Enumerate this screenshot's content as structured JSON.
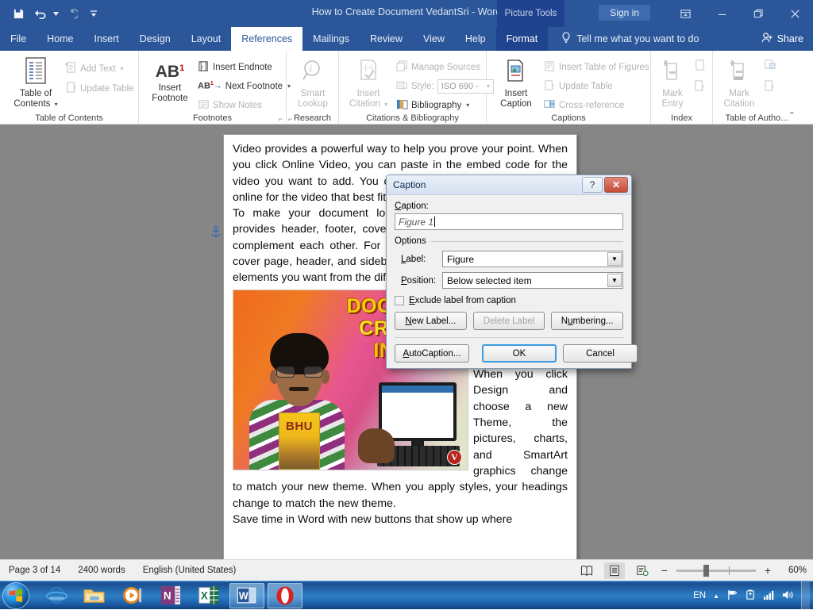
{
  "titlebar": {
    "document_title": "How to Create Document VedantSri  -  Word",
    "quick_access": [
      {
        "name": "save",
        "icon": "save-icon"
      },
      {
        "name": "undo",
        "icon": "undo-icon"
      },
      {
        "name": "redo",
        "icon": "redo-icon"
      },
      {
        "name": "customize",
        "icon": "customize-qat-icon"
      }
    ],
    "context_tools_label": "Picture Tools",
    "signin_label": "Sign in",
    "window_buttons": [
      {
        "name": "ribbon-display-options",
        "glyph": "⬒"
      },
      {
        "name": "minimize",
        "glyph": "—"
      },
      {
        "name": "restore",
        "glyph": "❐"
      },
      {
        "name": "close",
        "glyph": "✕"
      }
    ]
  },
  "tabs": [
    {
      "label": "File",
      "active": false
    },
    {
      "label": "Home",
      "active": false
    },
    {
      "label": "Insert",
      "active": false
    },
    {
      "label": "Design",
      "active": false
    },
    {
      "label": "Layout",
      "active": false
    },
    {
      "label": "References",
      "active": true
    },
    {
      "label": "Mailings",
      "active": false
    },
    {
      "label": "Review",
      "active": false
    },
    {
      "label": "View",
      "active": false
    },
    {
      "label": "Help",
      "active": false
    }
  ],
  "context_tab": {
    "label": "Format"
  },
  "tellme": {
    "placeholder": "Tell me what you want to do"
  },
  "share": {
    "label": "Share"
  },
  "ribbon": {
    "groups": [
      {
        "title": "Table of Contents",
        "big": {
          "label1": "Table of",
          "label2": "Contents",
          "dim": false
        },
        "items": [
          {
            "label": "Add Text",
            "dim": true,
            "has_caret": true
          },
          {
            "label": "Update Table",
            "dim": true,
            "has_caret": false
          }
        ]
      },
      {
        "title": "Footnotes",
        "big": {
          "label1": "Insert",
          "label2": "Footnote",
          "glyph": "AB",
          "sup": "1",
          "dim": false
        },
        "items": [
          {
            "label": "Insert Endnote",
            "dim": false,
            "has_caret": false
          },
          {
            "label": "Next Footnote",
            "dim": false,
            "has_caret": true
          },
          {
            "label": "Show Notes",
            "dim": true,
            "has_caret": false
          }
        ]
      },
      {
        "title": "Research",
        "big": {
          "label1": "Smart",
          "label2": "Lookup",
          "dim": true
        }
      },
      {
        "title": "Citations & Bibliography",
        "big": {
          "label1": "Insert",
          "label2": "Citation",
          "dim": true
        },
        "items": [
          {
            "label": "Manage Sources",
            "dim": true,
            "has_caret": false
          },
          {
            "label": "Style:",
            "dim": true,
            "has_caret": false
          },
          {
            "label": "Bibliography",
            "dim": false,
            "has_caret": true
          }
        ],
        "style_value": "ISO 690 -"
      },
      {
        "title": "Captions",
        "big": {
          "label1": "Insert",
          "label2": "Caption",
          "dim": false
        },
        "items": [
          {
            "label": "Insert Table of Figures",
            "dim": true,
            "has_caret": false
          },
          {
            "label": "Update Table",
            "dim": true,
            "has_caret": false
          },
          {
            "label": "Cross-reference",
            "dim": true,
            "has_caret": false
          }
        ]
      },
      {
        "title": "Index",
        "big": {
          "label1": "Mark",
          "label2": "Entry",
          "dim": true
        }
      },
      {
        "title": "Table of Autho...",
        "big": {
          "label1": "Mark",
          "label2": "Citation",
          "dim": true
        }
      }
    ],
    "collapse_label": "⌃"
  },
  "document": {
    "paragraph1": "Video provides a powerful way to help you prove your point. When you click Online Video, you can paste in the embed code for the video you want to add. You can also type a keyword to search online for the video that best fits your document.",
    "paragraph2": "To make your document look professionally produced, Word provides header, footer, cover page, and text box designs that complement each other. For example, you can add a matching cover page, header, and sidebar. Click Insert and then choose the elements you want from the different galleries.",
    "paragraph3": "Themes and styles also help keep your document coordinated. When you click Design and choose a new Theme, the pictures, charts, and SmartArt graphics change to match your new theme. When you apply styles, your headings change to match the new theme.",
    "paragraph4": "Save time in Word with new buttons that show up where",
    "image": {
      "title_line1": "DOCUMENT",
      "title_line2": "CREATION",
      "title_line3": "IN WORD",
      "book_label": "BHU",
      "logo_label": "V"
    }
  },
  "dialog": {
    "title": "Caption",
    "help_glyph": "?",
    "close_glyph": "✕",
    "caption_label": "Caption:",
    "caption_value": "Figure 1",
    "options_label": "Options",
    "label_field_label": "Label:",
    "label_value": "Figure",
    "position_field_label": "Position:",
    "position_value": "Below selected item",
    "exclude_label": "Exclude label from caption",
    "exclude_checked": false,
    "buttons": [
      {
        "label": "New Label...",
        "dim": false,
        "default": false
      },
      {
        "label": "Delete Label",
        "dim": true,
        "default": false
      },
      {
        "label": "Numbering...",
        "dim": false,
        "default": false
      }
    ],
    "buttons2": [
      {
        "label": "AutoCaption...",
        "dim": false,
        "default": false
      },
      {
        "label": "OK",
        "dim": false,
        "default": true
      },
      {
        "label": "Cancel",
        "dim": false,
        "default": false
      }
    ]
  },
  "statusbar": {
    "page": "Page 3 of 14",
    "words": "2400 words",
    "language": "English (United States)",
    "views": [
      {
        "name": "read-mode",
        "active": false
      },
      {
        "name": "print-layout",
        "active": true
      },
      {
        "name": "web-layout",
        "active": false
      }
    ],
    "zoom_out": "−",
    "zoom_in": "+",
    "zoom_level": "60%"
  },
  "taskbar": {
    "start_label": "Start",
    "items": [
      {
        "name": "internet-explorer",
        "label": "Internet Explorer",
        "running": false
      },
      {
        "name": "file-explorer",
        "label": "File Explorer",
        "running": false
      },
      {
        "name": "media-player",
        "label": "Windows Media Player",
        "running": false
      },
      {
        "name": "onenote",
        "label": "OneNote",
        "running": false
      },
      {
        "name": "excel",
        "label": "Excel",
        "running": false
      },
      {
        "name": "word",
        "label": "Word",
        "running": true
      },
      {
        "name": "opera",
        "label": "Opera",
        "running": true
      }
    ],
    "tray": {
      "language": "EN",
      "icons": [
        {
          "name": "show-hidden-icons",
          "glyph": "▲"
        },
        {
          "name": "action-center-flag",
          "glyph": "⚑"
        },
        {
          "name": "battery",
          "glyph": "▯"
        },
        {
          "name": "network-signal",
          "glyph": "▂"
        },
        {
          "name": "volume",
          "glyph": "🔊"
        }
      ]
    }
  }
}
